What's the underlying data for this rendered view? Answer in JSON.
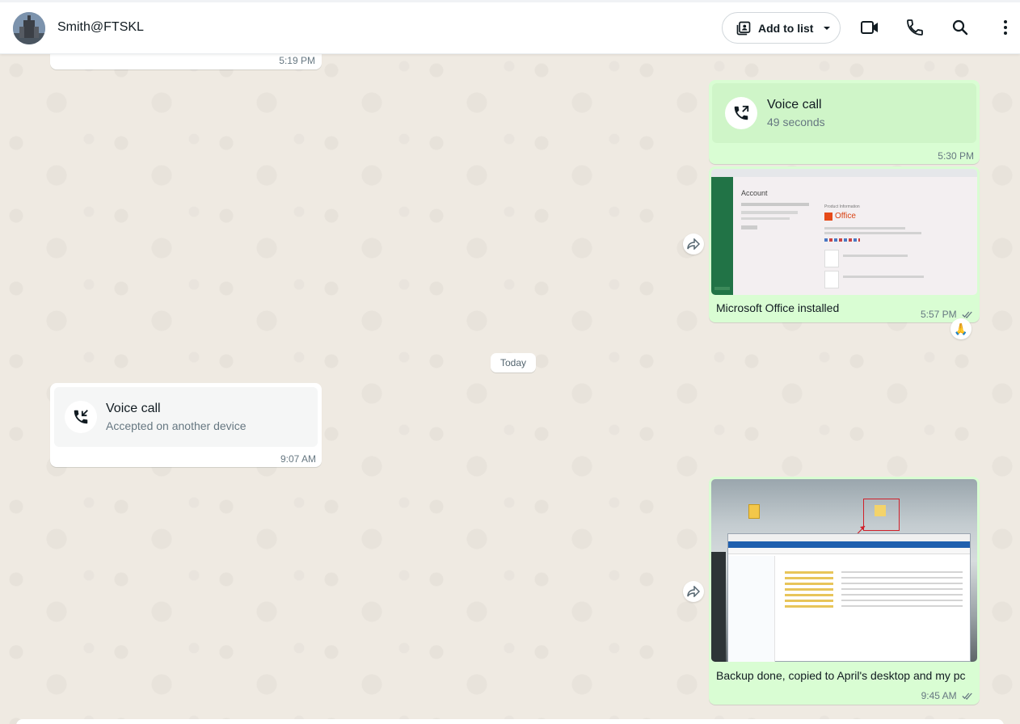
{
  "header": {
    "contact_name": "Smith@FTSKL",
    "add_to_list_label": "Add to list"
  },
  "messages": [
    {
      "id": "m0",
      "direction": "incoming",
      "time": "5:19 PM"
    },
    {
      "id": "m1",
      "direction": "outgoing",
      "type": "voice-call",
      "title": "Voice call",
      "subtitle": "49 seconds",
      "time": "5:30 PM"
    },
    {
      "id": "m2",
      "direction": "outgoing",
      "type": "image",
      "caption": "Microsoft Office installed",
      "time": "5:57 PM",
      "status": "read",
      "reaction": "🙏",
      "image": {
        "heading": "Account",
        "product_info": "Product Information",
        "logo_text": "Office"
      }
    },
    {
      "id": "m3",
      "direction": "incoming",
      "type": "voice-call",
      "title": "Voice call",
      "subtitle": "Accepted on another device",
      "time": "9:07 AM"
    },
    {
      "id": "m4",
      "direction": "outgoing",
      "type": "image",
      "caption": "Backup done, copied to April's desktop and my pc",
      "time": "9:45 AM",
      "status": "read"
    }
  ],
  "date_divider": "Today",
  "icons": {
    "add_to_list": "contact-list-icon",
    "dropdown": "chevron-down-icon",
    "video": "video-camera-icon",
    "voice": "phone-icon",
    "search": "search-icon",
    "menu": "kebab-menu-icon",
    "forward": "forward-icon"
  },
  "colors": {
    "chat_background": "#efeae2",
    "outgoing_bubble": "#d9fdd3",
    "incoming_bubble": "#ffffff",
    "tick_read": "#667781"
  }
}
